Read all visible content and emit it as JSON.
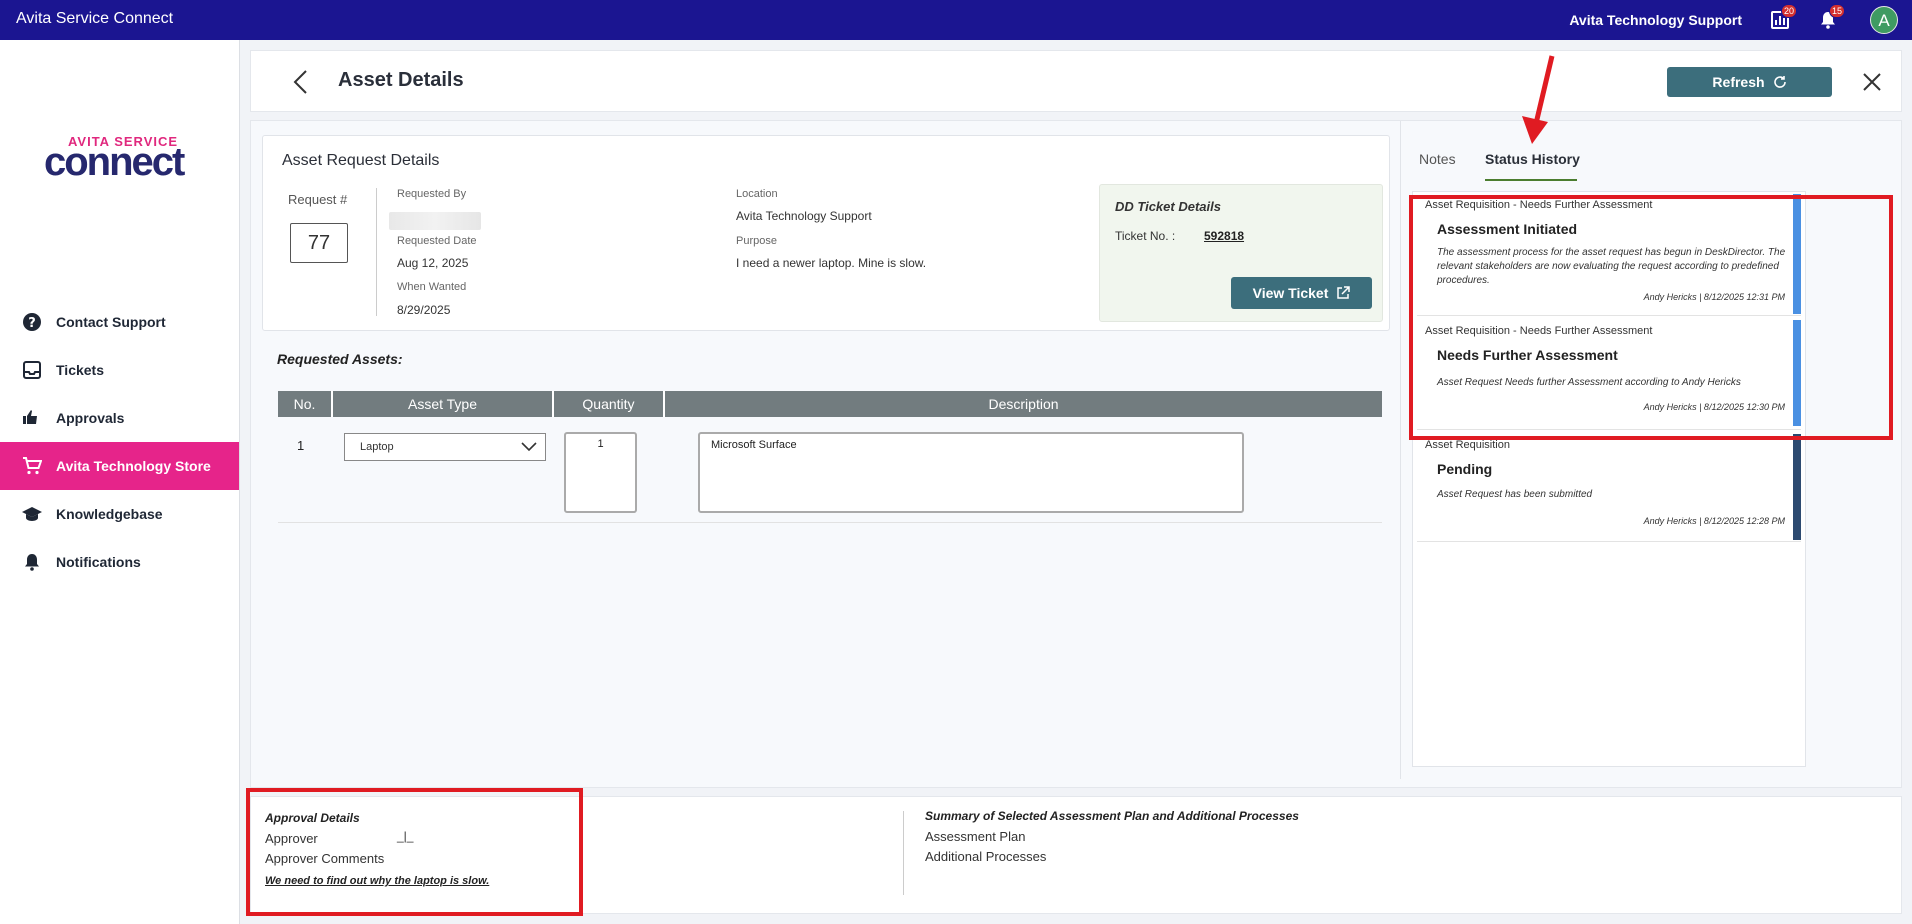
{
  "topbar": {
    "app_title": "Avita Service Connect",
    "org_name": "Avita Technology Support",
    "reports_badge": "20",
    "notifications_badge": "15",
    "avatar_initial": "A"
  },
  "logo": {
    "top": "AVITA SERVICE",
    "main": "connect"
  },
  "sidebar": {
    "items": [
      {
        "label": "Contact Support",
        "icon": "help-circle-icon",
        "active": false
      },
      {
        "label": "Tickets",
        "icon": "inbox-icon",
        "active": false
      },
      {
        "label": "Approvals",
        "icon": "thumbs-icon",
        "active": false
      },
      {
        "label": "Avita Technology Store",
        "icon": "cart-icon",
        "active": true
      },
      {
        "label": "Knowledgebase",
        "icon": "graduation-cap-icon",
        "active": false
      },
      {
        "label": "Notifications",
        "icon": "bell-icon",
        "active": false
      }
    ]
  },
  "header": {
    "title": "Asset Details",
    "refresh_label": "Refresh"
  },
  "request": {
    "section_title": "Asset Request Details",
    "number_label": "Request #",
    "number": "77",
    "requested_by_label": "Requested By",
    "requested_date_label": "Requested Date",
    "requested_date": "Aug 12, 2025",
    "when_wanted_label": "When Wanted",
    "when_wanted": "8/29/2025",
    "location_label": "Location",
    "location": "Avita Technology Support",
    "purpose_label": "Purpose",
    "purpose": "I need a newer laptop. Mine is slow."
  },
  "ticket": {
    "title": "DD Ticket Details",
    "number_label": "Ticket No. :",
    "number": "592818",
    "view_label": "View Ticket"
  },
  "assets": {
    "title": "Requested Assets:",
    "columns": [
      "No.",
      "Asset Type",
      "Quantity",
      "Description"
    ],
    "rows": [
      {
        "no": "1",
        "type": "Laptop",
        "quantity": "1",
        "description": "Microsoft Surface"
      }
    ]
  },
  "tabs": {
    "notes": "Notes",
    "status_history": "Status History"
  },
  "history": [
    {
      "category": "Asset Requisition - Needs Further Assessment",
      "title": "Assessment Initiated",
      "description": "The assessment process for the asset request has begun in DeskDirector. The relevant stakeholders are now evaluating the request according to predefined procedures.",
      "meta": "Andy Hericks | 8/12/2025 12:31 PM",
      "bar_color": "#4a90e2"
    },
    {
      "category": "Asset Requisition - Needs Further Assessment",
      "title": "Needs Further Assessment",
      "description": "Asset Request Needs further Assessment according to Andy Hericks",
      "meta": "Andy Hericks | 8/12/2025 12:30 PM",
      "bar_color": "#4a90e2"
    },
    {
      "category": "Asset Requisition",
      "title": "Pending",
      "description": "Asset Request has been submitted",
      "meta": "Andy Hericks | 8/12/2025 12:28 PM",
      "bar_color": "#2c4a70"
    }
  ],
  "approval": {
    "title": "Approval Details",
    "approver_label": "Approver",
    "approver_value": "_|_",
    "comments_label": "Approver Comments",
    "comment": "We need to find out why the laptop is slow."
  },
  "summary": {
    "title": "Summary of Selected Assessment Plan and Additional Processes",
    "assessment_plan_label": "Assessment Plan",
    "additional_processes_label": "Additional Processes"
  },
  "colors": {
    "topbar": "#1b1591",
    "active_nav": "#e6248a",
    "button": "#3c6e7c",
    "annotation": "#e01b22"
  }
}
